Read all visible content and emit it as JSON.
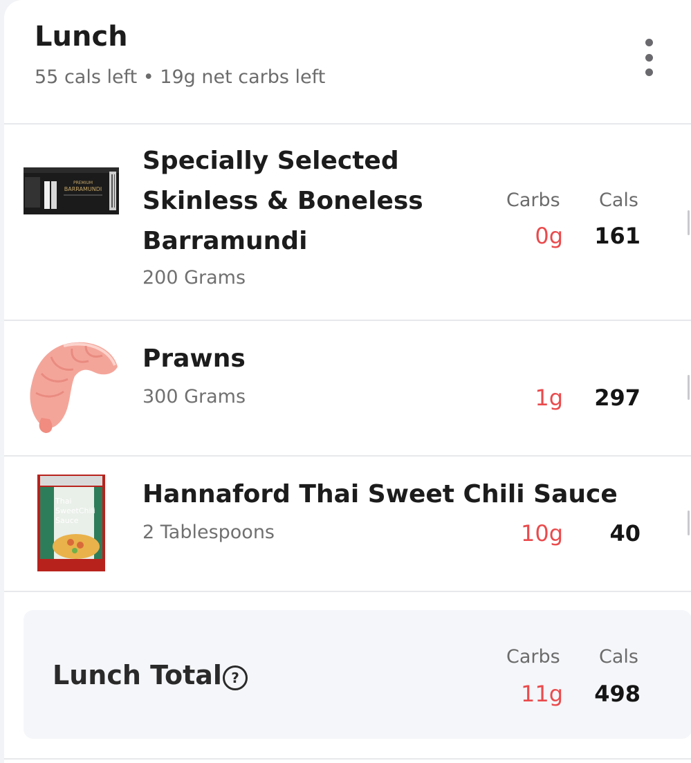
{
  "meal": {
    "title": "Lunch",
    "subtitle": "55 cals left • 19g net carbs left"
  },
  "columns": {
    "carbs_label": "Carbs",
    "cals_label": "Cals"
  },
  "items": [
    {
      "name": "Specially Selected Skinless & Boneless Barramundi",
      "amount": "200 Grams",
      "carbs": "0g",
      "cals": "161",
      "image_icon": "barramundi-package-icon",
      "package_text": "PREMIUM BARRAMUNDI"
    },
    {
      "name": "Prawns",
      "amount": "300 Grams",
      "carbs": "1g",
      "cals": "297",
      "image_icon": "prawn-icon"
    },
    {
      "name": "Hannaford Thai Sweet Chili Sauce",
      "amount": "2 Tablespoons",
      "carbs": "10g",
      "cals": "40",
      "image_icon": "chili-sauce-bottle-icon",
      "label_text": "Thai Sweet Chili Sauce"
    }
  ],
  "total": {
    "label": "Lunch Total",
    "help_symbol": "?",
    "carbs": "11g",
    "cals": "498"
  },
  "colors": {
    "carbs": "#ea4a4c",
    "background": "#f2f3f6",
    "card": "#ffffff"
  }
}
